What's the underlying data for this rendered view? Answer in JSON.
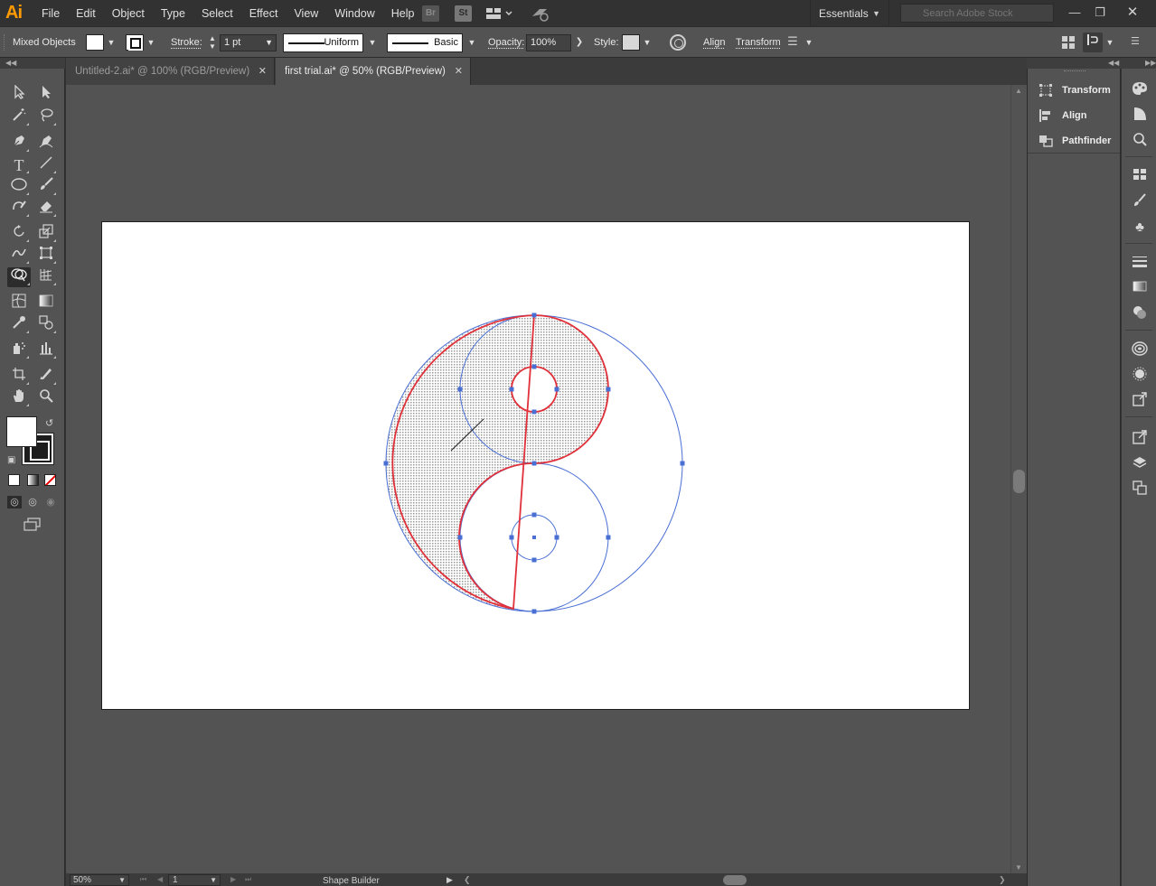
{
  "app": {
    "logo": "Ai"
  },
  "menu": [
    "File",
    "Edit",
    "Object",
    "Type",
    "Select",
    "Effect",
    "View",
    "Window",
    "Help"
  ],
  "menubar_icons": {
    "bridge": "Br",
    "stock": "St",
    "workspace": "workspace-switcher-icon",
    "gpu": "gpu-performance-icon"
  },
  "workspace": {
    "label": "Essentials"
  },
  "search": {
    "placeholder": "Search Adobe Stock"
  },
  "window_controls": {
    "minimize": "—",
    "maximize": "❐",
    "close": "✕"
  },
  "control_bar": {
    "selection": "Mixed Objects",
    "stroke_label": "Stroke:",
    "stroke_weight": "1 pt",
    "profile": "Uniform",
    "brush": "Basic",
    "opacity_label": "Opacity:",
    "opacity": "100%",
    "style_label": "Style:",
    "align_link": "Align",
    "transform_link": "Transform",
    "colors": {
      "fill": "#ffffff",
      "stroke": "#000000",
      "style": "#d8d8d8"
    }
  },
  "tabs": [
    {
      "label": "Untitled-2.ai* @ 100% (RGB/Preview)",
      "active": false,
      "close": "✕"
    },
    {
      "label": "first trial.ai* @ 50% (RGB/Preview)",
      "active": true,
      "close": "✕"
    }
  ],
  "tools": [
    "selection-tool",
    "direct-selection-tool",
    "magic-wand-tool",
    "lasso-tool",
    "pen-tool",
    "curvature-tool",
    "type-tool",
    "line-segment-tool",
    "ellipse-tool",
    "paintbrush-tool",
    "shaper-tool",
    "eraser-tool",
    "rotate-tool",
    "scale-tool",
    "width-tool",
    "free-transform-tool",
    "shape-builder-tool",
    "perspective-grid-tool",
    "mesh-tool",
    "gradient-tool",
    "eyedropper-tool",
    "blend-tool",
    "symbol-sprayer-tool",
    "column-graph-tool",
    "artboard-tool",
    "slice-tool",
    "hand-tool",
    "zoom-tool"
  ],
  "status": {
    "zoom": "50%",
    "page": "1",
    "current_tool": "Shape Builder"
  },
  "panels": [
    {
      "label": "Transform",
      "icon": "transform-icon"
    },
    {
      "label": "Align",
      "icon": "align-icon"
    },
    {
      "label": "Pathfinder",
      "icon": "pathfinder-icon"
    }
  ],
  "side_icons": [
    "color-icon",
    "color-guide-icon",
    "cc-libraries-icon",
    "swatches-icon",
    "brushes-icon",
    "symbols-icon",
    "stroke-icon",
    "gradient-icon",
    "transparency-icon",
    "appearance-icon",
    "graphic-styles-icon",
    "asset-export-icon",
    "export-icon",
    "layers-icon",
    "artboards-icon"
  ],
  "artwork_colors": {
    "selection_blue": "#4a6fd4",
    "path_red": "#e0303a",
    "artboard": "#ffffff",
    "pasteboard": "#535353"
  }
}
